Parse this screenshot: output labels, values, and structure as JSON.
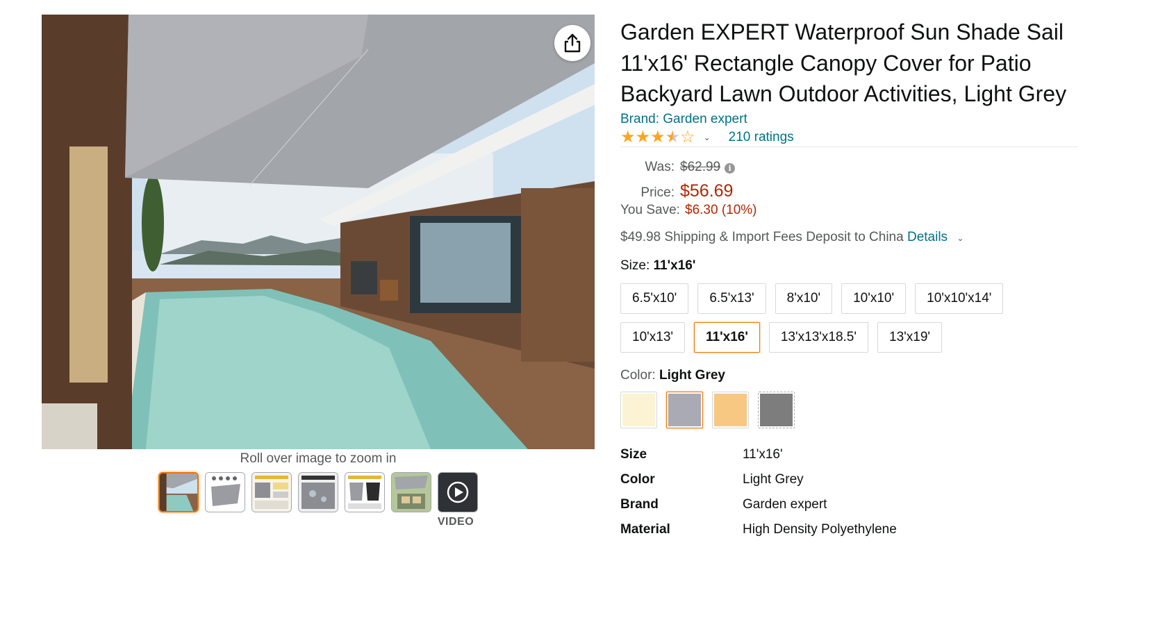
{
  "gallery": {
    "zoom_hint": "Roll over image to zoom in",
    "video_label": "VIDEO",
    "thumbnails": [
      "thumbnail-pool",
      "thumbnail-shade-grey",
      "thumbnail-infographic-features",
      "thumbnail-waterproof",
      "thumbnail-comparison",
      "thumbnail-patio",
      "thumbnail-video"
    ],
    "selected_thumbnail": 0
  },
  "product": {
    "title": "Garden EXPERT Waterproof Sun Shade Sail 11'x16' Rectangle Canopy Cover for Patio Backyard Lawn Outdoor Activities, Light Grey",
    "brand_link": "Brand: Garden expert",
    "rating_stars": 3.5,
    "ratings_count": "210 ratings"
  },
  "pricing": {
    "was_label": "Was:",
    "was_value": "$62.99",
    "price_label": "Price:",
    "price_value": "$56.69",
    "save_label": "You Save:",
    "save_value": "$6.30 (10%)",
    "shipping_text": "$49.98 Shipping & Import Fees Deposit to China",
    "details_link": "Details"
  },
  "size": {
    "label": "Size:",
    "selected": "11'x16'",
    "options": [
      "6.5'x10'",
      "6.5'x13'",
      "8'x10'",
      "10'x10'",
      "10'x10'x14'",
      "10'x13'",
      "11'x16'",
      "13'x13'x18.5'",
      "13'x19'"
    ]
  },
  "color": {
    "label": "Color:",
    "selected": "Light Grey",
    "swatches": [
      {
        "name": "cream",
        "hex": "#fbf3d4"
      },
      {
        "name": "light-grey",
        "hex": "#a9aab3"
      },
      {
        "name": "sand",
        "hex": "#f6c882"
      },
      {
        "name": "dark-grey",
        "hex": "#7d7d7d"
      }
    ]
  },
  "specs": [
    {
      "key": "Size",
      "value": "11'x16'"
    },
    {
      "key": "Color",
      "value": "Light Grey"
    },
    {
      "key": "Brand",
      "value": "Garden expert"
    },
    {
      "key": "Material",
      "value": "High Density Polyethylene"
    }
  ],
  "colors": {
    "link": "#007185",
    "price": "#b12704",
    "star": "#ffa41c",
    "selected_border": "#e77600"
  }
}
